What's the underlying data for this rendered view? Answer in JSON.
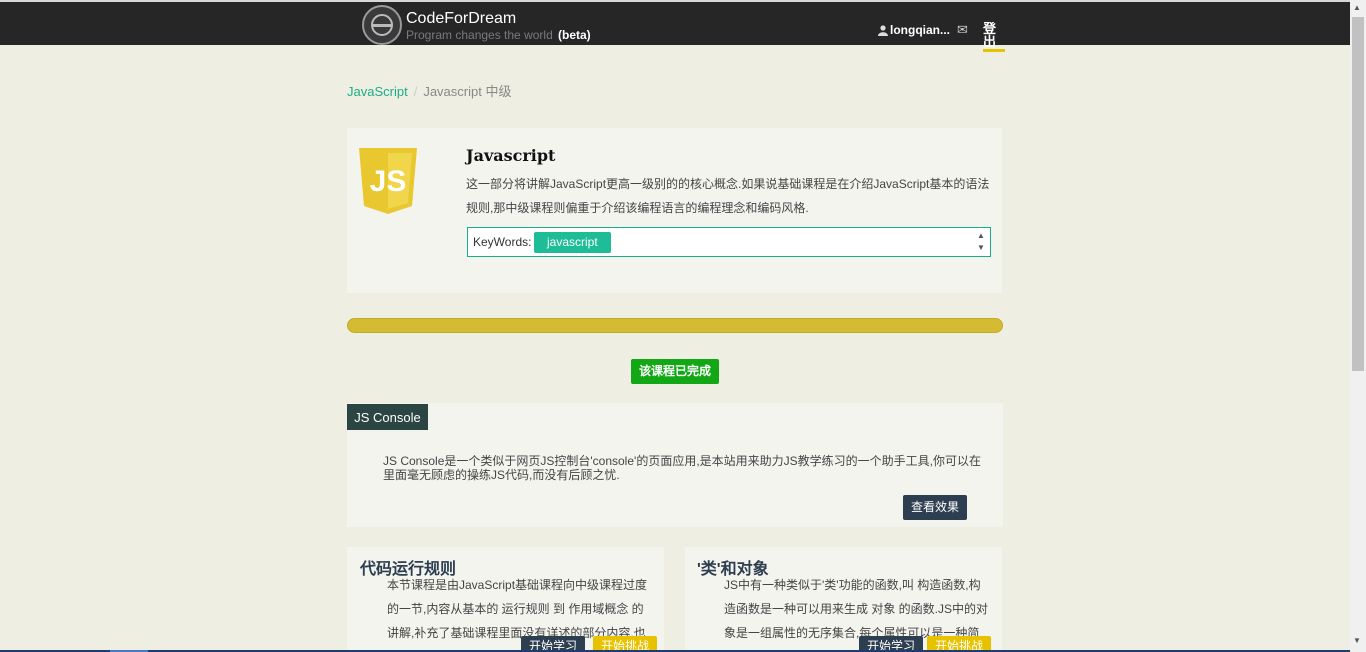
{
  "header": {
    "brand": "CodeForDream",
    "slogan": "Program changes the world",
    "beta": "(beta)",
    "username": "longqian...",
    "logout": "登出"
  },
  "breadcrumb": {
    "parent": "JavaScript",
    "separator": "/",
    "current": "Javascript 中级"
  },
  "course": {
    "logo_text": "JS",
    "title": "Javascript",
    "description": "这一部分将讲解JavaScript更高一级别的的核心概念.如果说基础课程是在介绍JavaScript基本的语法规则,那中级课程则偏重于介绍该编程语言的编程理念和编码风格.",
    "keywords_label": "KeyWords:",
    "keywords": [
      "javascript"
    ]
  },
  "progress": {
    "fraction": 1.0
  },
  "complete_button": "该课程已完成",
  "console": {
    "tab": "JS Console",
    "description": "JS Console是一个类似于网页JS控制台'console'的页面应用,是本站用来助力JS教学练习的一个助手工具,你可以在里面毫无顾虑的操练JS代码,而没有后顾之忧.",
    "button": "查看效果"
  },
  "lessons": [
    {
      "title": "代码运行规则",
      "description": "本节课程是由JavaScript基础课程向中级课程过度的一节,内容从基本的 运行规则 到 作用域概念 的讲解,补充了基础课程里面没有详述的部分内容,也是",
      "study_button": "开始学习",
      "challenge_button": "开始挑战"
    },
    {
      "title": "'类'和对象",
      "description": "JS中有一种类似于'类'功能的函数,叫 构造函数,构造函数是一种可以用来生成 对象 的函数.JS中的对象是一组属性的无序集合,每个属性可以是一种简",
      "study_button": "开始学习",
      "challenge_button": "开始挑战"
    }
  ],
  "colors": {
    "topbar": "#262626",
    "page_bg": "#eeeee3",
    "accent_green": "#1aae88",
    "progress_yellow": "#d4bb33",
    "complete_green": "#12a815",
    "dark_button": "#2d3e50",
    "js_logo": "#e8c82e"
  },
  "icons": [
    "logo-icon",
    "user-icon",
    "mail-icon",
    "js-logo-icon",
    "spinner-up-icon",
    "spinner-down-icon"
  ]
}
